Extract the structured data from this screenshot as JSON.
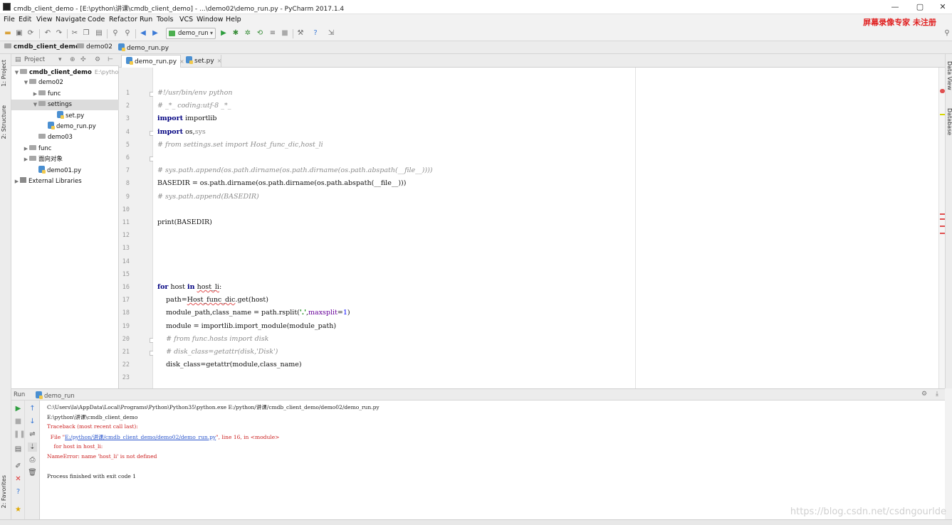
{
  "window": {
    "title": "cmdb_client_demo - [E:\\python\\讲课\\cmdb_client_demo] - ...\\demo02\\demo_run.py - PyCharm 2017.1.4",
    "controls": [
      "—",
      "▢",
      "✕"
    ]
  },
  "menu": {
    "items": [
      "File",
      "Edit",
      "View",
      "Navigate",
      "Code",
      "Refactor",
      "Run",
      "Tools",
      "VCS",
      "Window",
      "Help"
    ],
    "watermark": "屏幕录像专家 未注册"
  },
  "toolbar": {
    "run_config": "demo_run",
    "icons": [
      "open-icon",
      "save-icon",
      "sync-icon",
      "undo-icon",
      "redo-icon",
      "cut-icon",
      "copy-icon",
      "paste-icon",
      "find-icon",
      "replace-icon",
      "back-icon",
      "forward-icon",
      "run-icon",
      "debug-icon",
      "coverage-icon",
      "profile-icon",
      "concurrency-icon",
      "stop-icon",
      "settings-icon",
      "help-icon",
      "structure-icon"
    ]
  },
  "breadcrumb": {
    "items": [
      "cmdb_client_demo",
      "demo02",
      "demo_run.py"
    ]
  },
  "left_strip": {
    "tabs": [
      "1: Project",
      "2: Structure",
      "2: Favorites"
    ]
  },
  "right_strip": {
    "tabs": [
      "Data View",
      "Database"
    ]
  },
  "project": {
    "header": "Project",
    "tree": [
      {
        "label": "cmdb_client_demo",
        "extra": "E:\\python",
        "indent": 0,
        "arrow": "▼",
        "type": "folder",
        "bold": true
      },
      {
        "label": "demo02",
        "indent": 1,
        "arrow": "▼",
        "type": "folder"
      },
      {
        "label": "func",
        "indent": 2,
        "arrow": "▶",
        "type": "folder"
      },
      {
        "label": "settings",
        "indent": 2,
        "arrow": "▼",
        "type": "folder",
        "selected": true
      },
      {
        "label": "set.py",
        "indent": 4,
        "arrow": "",
        "type": "py"
      },
      {
        "label": "demo_run.py",
        "indent": 3,
        "arrow": "",
        "type": "py"
      },
      {
        "label": "demo03",
        "indent": 2,
        "arrow": "",
        "type": "folder"
      },
      {
        "label": "func",
        "indent": 1,
        "arrow": "▶",
        "type": "folder"
      },
      {
        "label": "面向对象",
        "indent": 1,
        "arrow": "▶",
        "type": "folder"
      },
      {
        "label": "demo01.py",
        "indent": 2,
        "arrow": "",
        "type": "py"
      },
      {
        "label": "External Libraries",
        "indent": 0,
        "arrow": "▶",
        "type": "lib"
      }
    ]
  },
  "editor": {
    "tabs": [
      {
        "label": "demo_run.py",
        "active": true
      },
      {
        "label": "set.py",
        "active": false
      }
    ],
    "lines": [
      {
        "n": "1",
        "html": "<span class='cm'>#!/usr/bin/env python</span>"
      },
      {
        "n": "2",
        "html": "<span class='cm'># _*_ coding:utf-8 _*_</span>"
      },
      {
        "n": "3",
        "html": "<span class='kw'>import</span> importlib"
      },
      {
        "n": "4",
        "html": "<span class='kw'>import</span> os,<span class='grey'>sys</span>"
      },
      {
        "n": "5",
        "html": "<span class='cm'># from settings.set import Host_func_dic,host_li</span>"
      },
      {
        "n": "6",
        "html": ""
      },
      {
        "n": "7",
        "html": "<span class='cm'># sys.path.append(os.path.dirname(os.path.dirname(os.path.abspath(__file__))))</span>"
      },
      {
        "n": "8",
        "html": "BASEDIR = os.path.dirname(os.path.dirname(os.path.abspath(__file__)))"
      },
      {
        "n": "9",
        "html": "<span class='cm'># sys.path.append(BASEDIR)</span>"
      },
      {
        "n": "10",
        "html": ""
      },
      {
        "n": "11",
        "html": "print(BASEDIR)"
      },
      {
        "n": "12",
        "html": ""
      },
      {
        "n": "13",
        "html": ""
      },
      {
        "n": "14",
        "html": ""
      },
      {
        "n": "15",
        "html": ""
      },
      {
        "n": "16",
        "html": "<span class='kw'>for</span> host <span class='kw'>in</span> <span class='err'>host_li</span>:"
      },
      {
        "n": "17",
        "html": "    path=<span class='err'>Host_func_dic</span>.get(host)"
      },
      {
        "n": "18",
        "html": "    module_path,class_name = path.rsplit(<span class='str'>'.'</span>,<span class='param'>maxsplit</span>=<span class='num'>1</span>)"
      },
      {
        "n": "19",
        "html": "    module = importlib.import_module(module_path)"
      },
      {
        "n": "20",
        "html": "    <span class='cm'># from func.hosts import disk</span>"
      },
      {
        "n": "21",
        "html": "    <span class='cm'># disk_class=getattr(disk,'Disk')</span>"
      },
      {
        "n": "22",
        "html": "    disk_class=getattr(module,class_name)"
      },
      {
        "n": "23",
        "html": ""
      }
    ]
  },
  "run": {
    "label": "Run",
    "tab": "demo_run",
    "console": [
      {
        "text": "C:\\Users\\la\\AppData\\Local\\Programs\\Python\\Python35\\python.exe E:/python/讲课/cmdb_client_demo/demo02/demo_run.py",
        "cls": ""
      },
      {
        "text": "E:\\python\\讲课\\cmdb_client_demo",
        "cls": ""
      },
      {
        "text": "Traceback (most recent call last):",
        "cls": "red"
      },
      {
        "text": "  File \"E:/python/讲课/cmdb_client_demo/demo02/demo_run.py\", line 16, in <module>",
        "cls": "red"
      },
      {
        "text": "    for host in host_li:",
        "cls": "red"
      },
      {
        "text": "NameError: name 'host_li' is not defined",
        "cls": "red"
      },
      {
        "text": "",
        "cls": ""
      },
      {
        "text": "Process finished with exit code 1",
        "cls": ""
      }
    ]
  },
  "blog_watermark": "https://blog.csdn.net/csdngourlde",
  "colors": {
    "keyword": "#000080",
    "comment": "#8c8c8c",
    "string": "#008000",
    "error": "#cc2222",
    "watermark_red": "#e02020"
  }
}
